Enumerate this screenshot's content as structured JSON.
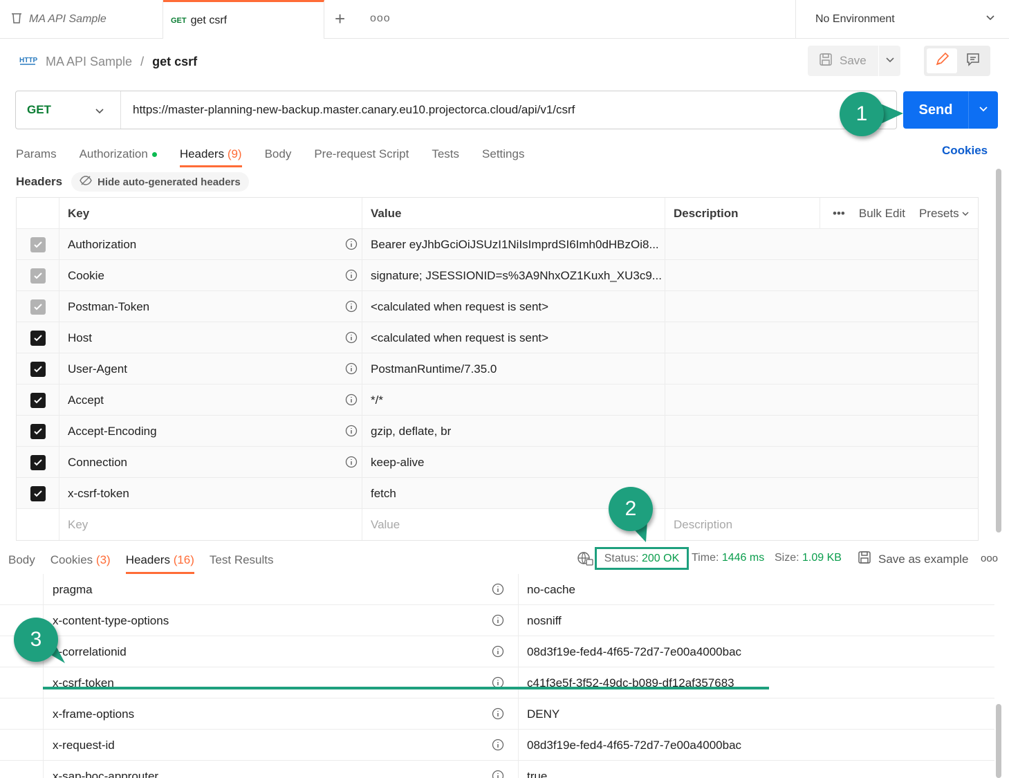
{
  "tabs": {
    "collection_tab": "MA API Sample",
    "request_tab_method": "GET",
    "request_tab_name": "get csrf",
    "plus": "+",
    "more": "ooo"
  },
  "environment": "No Environment",
  "breadcrumb": {
    "collection": "MA API Sample",
    "separator": "/",
    "request": "get csrf"
  },
  "toolbar": {
    "save_label": "Save"
  },
  "request": {
    "method": "GET",
    "url": "https://master-planning-new-backup.master.canary.eu10.projectorca.cloud/api/v1/csrf",
    "send_label": "Send"
  },
  "request_tabs": {
    "params": "Params",
    "authorization": "Authorization",
    "headers": "Headers",
    "headers_count": "(9)",
    "body": "Body",
    "prerequest": "Pre-request Script",
    "tests": "Tests",
    "settings": "Settings",
    "cookies": "Cookies"
  },
  "headers_section": {
    "label": "Headers",
    "hide_auto": "Hide auto-generated headers",
    "col_key": "Key",
    "col_value": "Value",
    "col_description": "Description",
    "more": "•••",
    "bulk_edit": "Bulk Edit",
    "presets": "Presets",
    "key_placeholder": "Key",
    "value_placeholder": "Value",
    "description_placeholder": "Description",
    "rows": [
      {
        "key": "Authorization",
        "value": "Bearer eyJhbGciOiJSUzI1NiIsImprdSI6Imh0dHBzOi8...",
        "state": "dim"
      },
      {
        "key": "Cookie",
        "value": "signature; JSESSIONID=s%3A9NhxOZ1Kuxh_XU3c9...",
        "state": "dim"
      },
      {
        "key": "Postman-Token",
        "value": "<calculated when request is sent>",
        "state": "dim"
      },
      {
        "key": "Host",
        "value": "<calculated when request is sent>",
        "state": "on"
      },
      {
        "key": "User-Agent",
        "value": "PostmanRuntime/7.35.0",
        "state": "on"
      },
      {
        "key": "Accept",
        "value": "*/*",
        "state": "on"
      },
      {
        "key": "Accept-Encoding",
        "value": "gzip, deflate, br",
        "state": "on"
      },
      {
        "key": "Connection",
        "value": "keep-alive",
        "state": "on"
      },
      {
        "key": "x-csrf-token",
        "value": "fetch",
        "state": "on"
      }
    ]
  },
  "response_tabs": {
    "body": "Body",
    "cookies": "Cookies",
    "cookies_count": "(3)",
    "headers": "Headers",
    "headers_count": "(16)",
    "test_results": "Test Results"
  },
  "response_status": {
    "status_label": "Status:",
    "status_value": "200 OK",
    "time_label": "Time:",
    "time_value": "1446 ms",
    "size_label": "Size:",
    "size_value": "1.09 KB",
    "save_example": "Save as example",
    "more": "ooo"
  },
  "response_headers": [
    {
      "key": "pragma",
      "value": "no-cache"
    },
    {
      "key": "x-content-type-options",
      "value": "nosniff"
    },
    {
      "key": "x-correlationid",
      "value": "08d3f19e-fed4-4f65-72d7-7e00a4000bac"
    },
    {
      "key": "x-csrf-token",
      "value": "c41f3e5f-3f52-49dc-b089-df12af357683"
    },
    {
      "key": "x-frame-options",
      "value": "DENY"
    },
    {
      "key": "x-request-id",
      "value": "08d3f19e-fed4-4f65-72d7-7e00a4000bac"
    },
    {
      "key": "x-sap-boc-approuter",
      "value": "true"
    }
  ],
  "callouts": [
    "1",
    "2",
    "3"
  ],
  "colors": {
    "accent_orange": "#ff6c37",
    "send_blue": "#0d6ff3",
    "callout_green": "#1ea07e",
    "method_green": "#0a7d33"
  },
  "icons": {
    "collection": "trash-box-icon",
    "http": "http-icon",
    "save": "save-disk-icon",
    "edit": "pencil-icon",
    "comment": "comment-icon",
    "info": "info-icon",
    "hide": "eye-off-icon",
    "network": "globe-icon"
  }
}
